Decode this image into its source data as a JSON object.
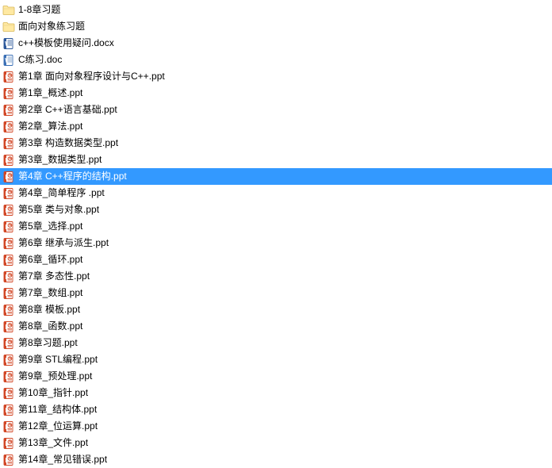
{
  "files": [
    {
      "name": "1-8章习题",
      "type": "folder",
      "selected": false
    },
    {
      "name": "面向对象练习题",
      "type": "folder",
      "selected": false
    },
    {
      "name": "c++模板使用疑问.docx",
      "type": "docx",
      "selected": false
    },
    {
      "name": "C练习.doc",
      "type": "doc",
      "selected": false
    },
    {
      "name": "第1章 面向对象程序设计与C++.ppt",
      "type": "ppt",
      "selected": false
    },
    {
      "name": "第1章_概述.ppt",
      "type": "ppt",
      "selected": false
    },
    {
      "name": "第2章 C++语言基础.ppt",
      "type": "ppt",
      "selected": false
    },
    {
      "name": "第2章_算法.ppt",
      "type": "ppt",
      "selected": false
    },
    {
      "name": "第3章 构造数据类型.ppt",
      "type": "ppt",
      "selected": false
    },
    {
      "name": "第3章_数据类型.ppt",
      "type": "ppt",
      "selected": false
    },
    {
      "name": "第4章 C++程序的结构.ppt",
      "type": "ppt",
      "selected": true
    },
    {
      "name": "第4章_简单程序 .ppt",
      "type": "ppt",
      "selected": false
    },
    {
      "name": "第5章 类与对象.ppt",
      "type": "ppt",
      "selected": false
    },
    {
      "name": "第5章_选择.ppt",
      "type": "ppt",
      "selected": false
    },
    {
      "name": "第6章 继承与派生.ppt",
      "type": "ppt",
      "selected": false
    },
    {
      "name": "第6章_循环.ppt",
      "type": "ppt",
      "selected": false
    },
    {
      "name": "第7章 多态性.ppt",
      "type": "ppt",
      "selected": false
    },
    {
      "name": "第7章_数组.ppt",
      "type": "ppt",
      "selected": false
    },
    {
      "name": "第8章 模板.ppt",
      "type": "ppt",
      "selected": false
    },
    {
      "name": "第8章_函数.ppt",
      "type": "ppt",
      "selected": false
    },
    {
      "name": "第8章习题.ppt",
      "type": "ppt",
      "selected": false
    },
    {
      "name": "第9章 STL编程.ppt",
      "type": "ppt",
      "selected": false
    },
    {
      "name": "第9章_预处理.ppt",
      "type": "ppt",
      "selected": false
    },
    {
      "name": "第10章_指针.ppt",
      "type": "ppt",
      "selected": false
    },
    {
      "name": "第11章_结构体.ppt",
      "type": "ppt",
      "selected": false
    },
    {
      "name": "第12章_位运算.ppt",
      "type": "ppt",
      "selected": false
    },
    {
      "name": "第13章_文件.ppt",
      "type": "ppt",
      "selected": false
    },
    {
      "name": "第14章_常见错误.ppt",
      "type": "ppt",
      "selected": false
    }
  ],
  "icons": {
    "folder": "folder-icon",
    "docx": "docx-icon",
    "doc": "doc-icon",
    "ppt": "ppt-icon"
  }
}
